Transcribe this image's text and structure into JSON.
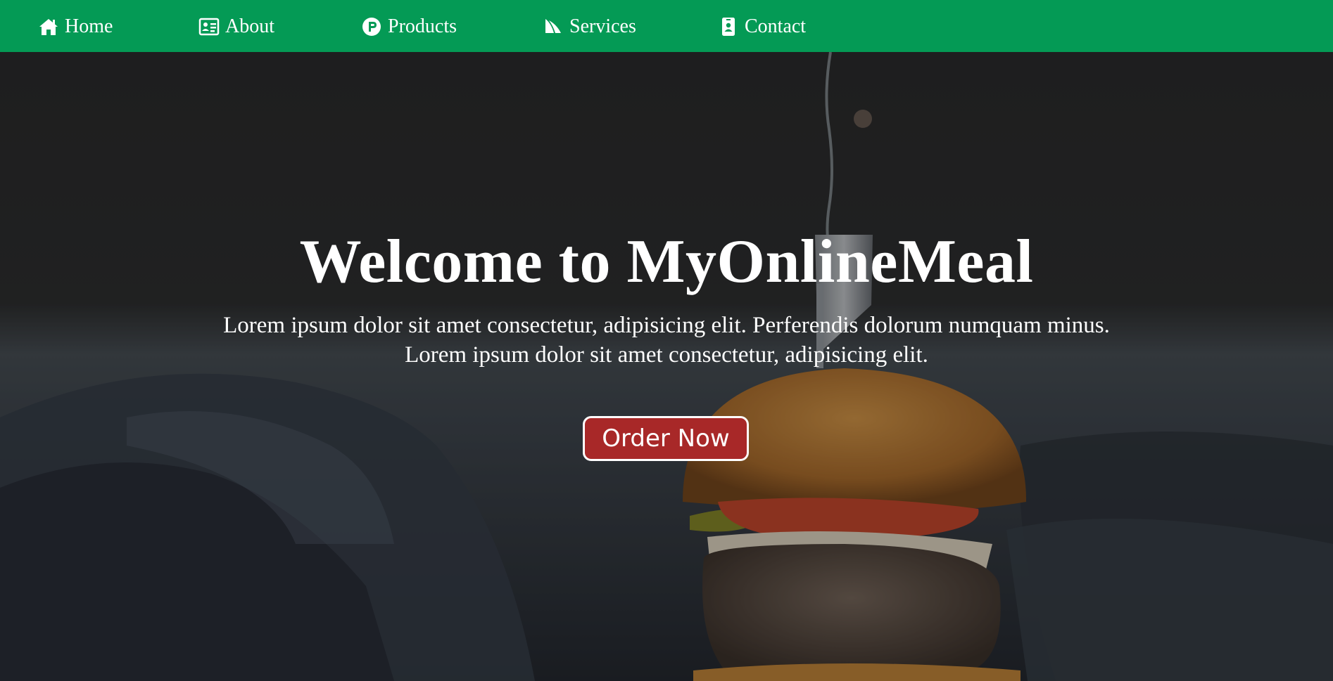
{
  "nav": {
    "items": [
      {
        "label": "Home",
        "icon": "home-icon"
      },
      {
        "label": "About",
        "icon": "id-card-icon"
      },
      {
        "label": "Products",
        "icon": "p-circle-icon"
      },
      {
        "label": "Services",
        "icon": "sail-icon"
      },
      {
        "label": "Contact",
        "icon": "badge-icon"
      }
    ],
    "background": "#049a55"
  },
  "hero": {
    "title": "Welcome to MyOnlineMeal",
    "line1": "Lorem ipsum dolor sit amet consectetur, adipisicing elit. Perferendis dolorum numquam minus.",
    "line2": "Lorem ipsum dolor sit amet consectetur, adipisicing elit.",
    "button_label": "Order Now",
    "button_color": "#a82828"
  }
}
